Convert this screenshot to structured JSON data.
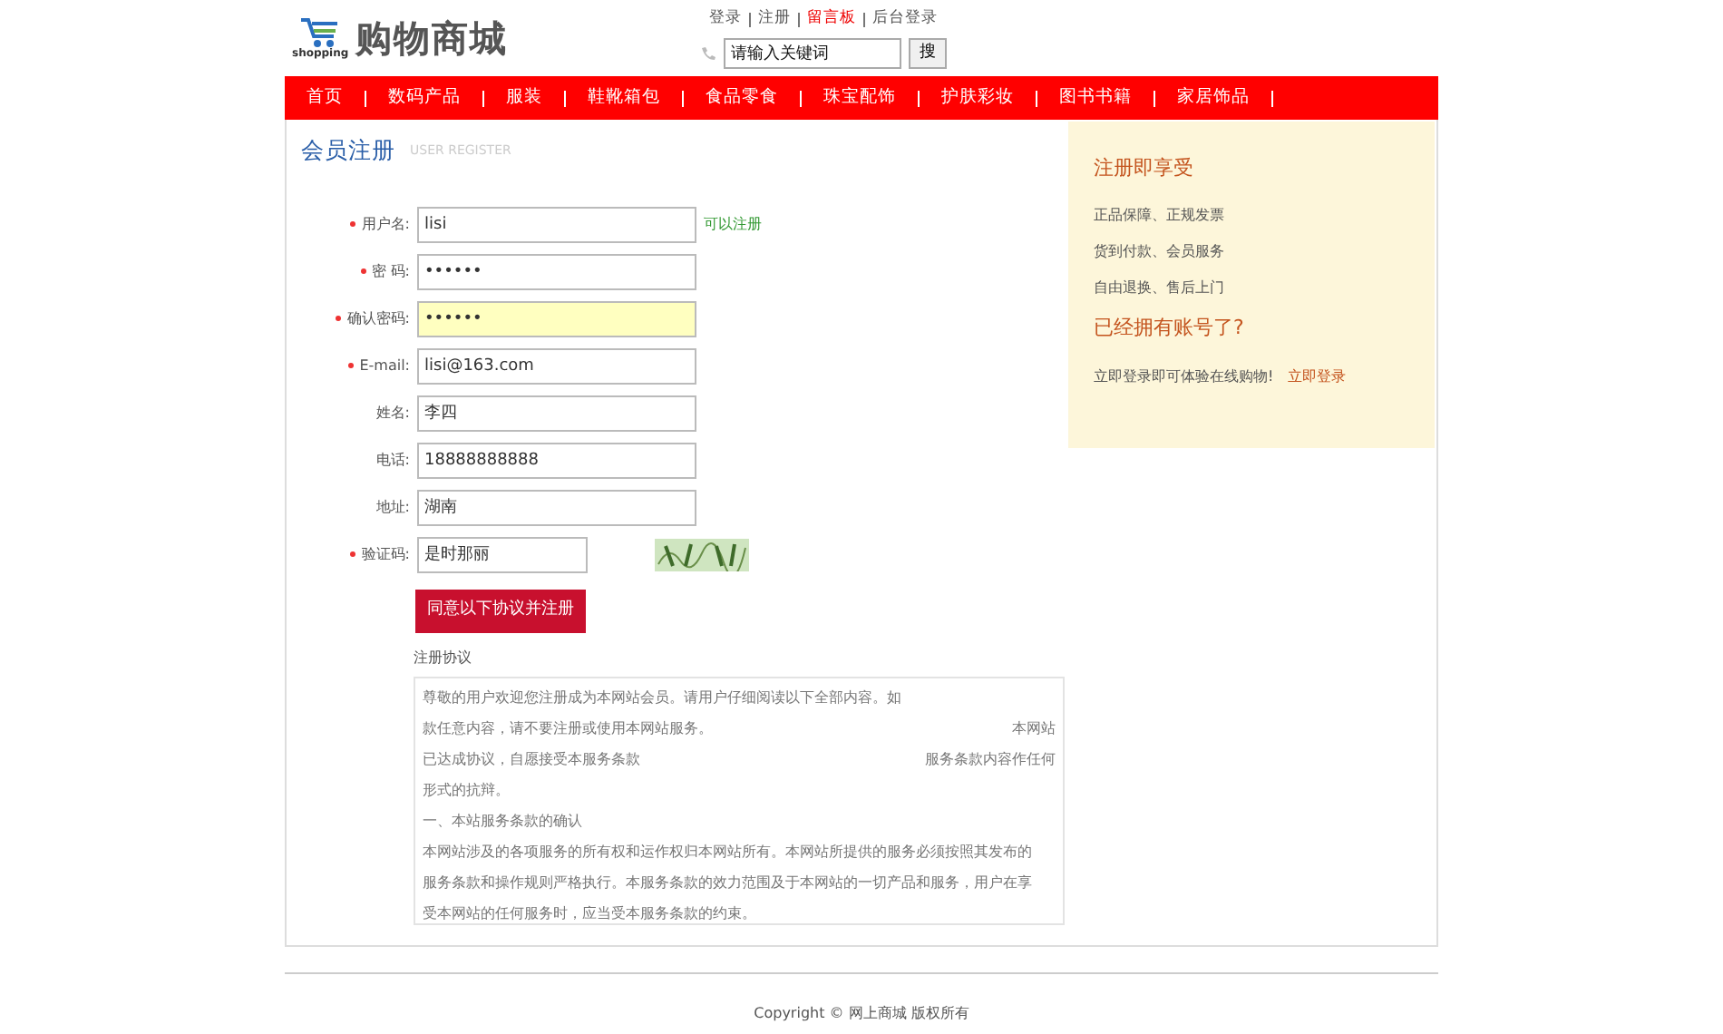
{
  "header": {
    "logo_caption": "shopping",
    "logo_title": "购物商城",
    "top_links": [
      {
        "label": "登录",
        "highlighted": false
      },
      {
        "label": "注册",
        "highlighted": false
      },
      {
        "label": "留言板",
        "highlighted": true
      },
      {
        "label": "后台登录",
        "highlighted": false
      }
    ],
    "search": {
      "value": "请输入关键词",
      "button": "搜"
    }
  },
  "nav": [
    "首页",
    "数码产品",
    "服装",
    "鞋靴箱包",
    "食品零食",
    "珠宝配饰",
    "护肤彩妆",
    "图书书籍",
    "家居饰品"
  ],
  "page_title": {
    "title": "会员注册",
    "subtitle": "USER REGISTER"
  },
  "form": {
    "fields": [
      {
        "label": "用户名:",
        "required": true,
        "value": "lisi",
        "highlighted": false,
        "hint": "可以注册"
      },
      {
        "label": "密  码:",
        "required": true,
        "value": "••••••",
        "highlighted": false
      },
      {
        "label": "确认密码:",
        "required": true,
        "value": "••••••",
        "highlighted": true
      },
      {
        "label": "E-mail:",
        "required": true,
        "value": "lisi@163.com",
        "highlighted": false
      },
      {
        "label": "姓名:",
        "required": false,
        "value": "李四",
        "highlighted": false
      },
      {
        "label": "电话:",
        "required": false,
        "value": "18888888888",
        "highlighted": false
      },
      {
        "label": "地址:",
        "required": false,
        "value": "湖南",
        "highlighted": false
      }
    ],
    "captcha": {
      "label": "验证码:",
      "required": true,
      "value": "是时那丽"
    },
    "submit": "同意以下协议并注册",
    "agreement_title": "注册协议",
    "agreement_lines": [
      {
        "left": "尊敬的用户欢迎您注册成为本网站会员。请用户仔细阅读以下全部内容。如"
      },
      {
        "left": "款任意内容，请不要注册或使用本网站服务。",
        "right": "本网站"
      },
      {
        "left": "已达成协议，自愿接受本服务条款",
        "right": "服务条款内容作任何"
      },
      {
        "left": "形式的抗辩。"
      },
      {
        "left": "一、本站服务条款的确认"
      },
      {
        "left": "本网站涉及的各项服务的所有权和运作权归本网站所有。本网站所提供的服务必须按照其发布的"
      },
      {
        "left": "服务条款和操作规则严格执行。本服务条款的效力范围及于本网站的一切产品和服务，用户在享"
      },
      {
        "left": "受本网站的任何服务时，应当受本服务条款的约束。"
      }
    ]
  },
  "side_panel": {
    "heading": "注册即享受",
    "benefits": [
      "正品保障、正规发票",
      "货到付款、会员服务",
      "自由退换、售后上门"
    ],
    "login_heading": "已经拥有账号了?",
    "login_text": "立即登录即可体验在线购物!",
    "login_link": "立即登录"
  },
  "footer": "Copyright © 网上商城 版权所有"
}
